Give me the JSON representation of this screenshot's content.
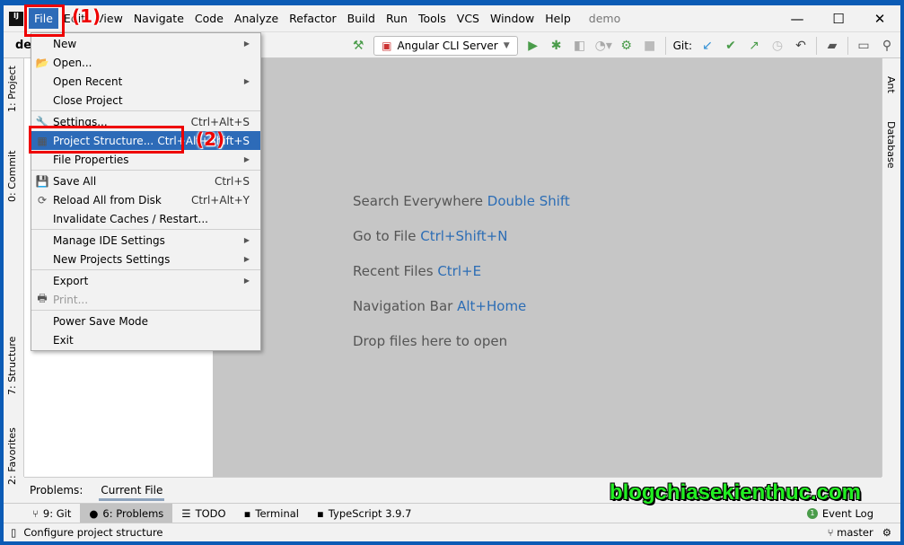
{
  "menubar": {
    "items": [
      "File",
      "Edit",
      "View",
      "Navigate",
      "Code",
      "Analyze",
      "Refactor",
      "Build",
      "Run",
      "Tools",
      "VCS",
      "Window",
      "Help"
    ],
    "title": "demo"
  },
  "toolbar": {
    "project": "demo",
    "run_config": "Angular CLI Server",
    "git_label": "Git:"
  },
  "left_tools": [
    "1: Project",
    "0: Commit",
    "7: Structure",
    "2: Favorites"
  ],
  "right_tools": [
    "Ant",
    "Database"
  ],
  "editor_hints": [
    {
      "text": "Search Everywhere",
      "key": "Double Shift"
    },
    {
      "text": "Go to File",
      "key": "Ctrl+Shift+N"
    },
    {
      "text": "Recent Files",
      "key": "Ctrl+E"
    },
    {
      "text": "Navigation Bar",
      "key": "Alt+Home"
    },
    {
      "text": "Drop files here to open",
      "key": ""
    }
  ],
  "file_menu": [
    {
      "label": "New",
      "shortcut": "",
      "submenu": true
    },
    {
      "label": "Open...",
      "shortcut": ""
    },
    {
      "label": "Open Recent",
      "shortcut": "",
      "submenu": true
    },
    {
      "label": "Close Project",
      "shortcut": ""
    },
    {
      "label": "Settings...",
      "shortcut": "Ctrl+Alt+S"
    },
    {
      "label": "Project Structure...",
      "shortcut": "Ctrl+Alt+Shift+S"
    },
    {
      "label": "File Properties",
      "shortcut": "",
      "submenu": true
    },
    {
      "label": "Save All",
      "shortcut": "Ctrl+S"
    },
    {
      "label": "Reload All from Disk",
      "shortcut": "Ctrl+Alt+Y"
    },
    {
      "label": "Invalidate Caches / Restart...",
      "shortcut": ""
    },
    {
      "label": "Manage IDE Settings",
      "shortcut": "",
      "submenu": true
    },
    {
      "label": "New Projects Settings",
      "shortcut": "",
      "submenu": true
    },
    {
      "label": "Export",
      "shortcut": "",
      "submenu": true
    },
    {
      "label": "Print...",
      "shortcut": "",
      "disabled": true
    },
    {
      "label": "Power Save Mode",
      "shortcut": ""
    },
    {
      "label": "Exit",
      "shortcut": ""
    }
  ],
  "problems": {
    "label": "Problems:",
    "tab": "Current File"
  },
  "bottom_tabs": [
    "9: Git",
    "6: Problems",
    "TODO",
    "Terminal",
    "TypeScript 3.9.7"
  ],
  "event_log": {
    "count": "1",
    "label": "Event Log"
  },
  "status": {
    "text": "Configure project structure",
    "branch": "master"
  },
  "annotations": {
    "step1": "(1)",
    "step2": "(2)",
    "watermark": "blogchiasekienthuc.com"
  },
  "colors": {
    "highlight": "#2d6bb8",
    "annotation": "#ee0000",
    "watermark": "#22ee22"
  }
}
